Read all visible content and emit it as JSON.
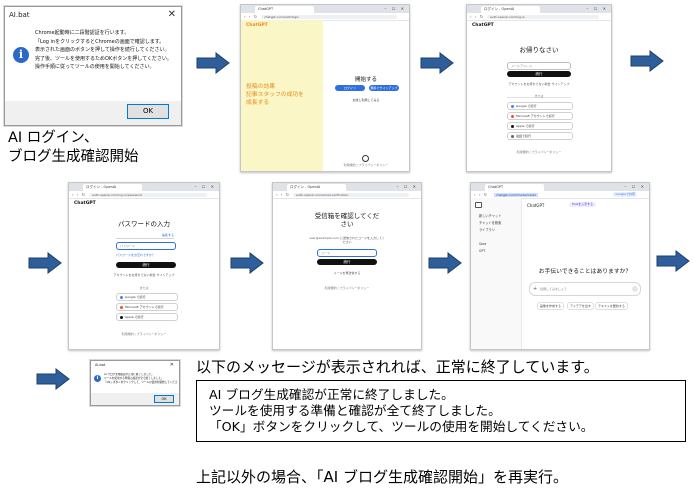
{
  "caption": {
    "line1": "AI ログイン、",
    "line2": "ブログ生成確認開始"
  },
  "dialog1": {
    "title": "AI.bat",
    "body_lines": [
      "Chrome起動時に二段階認証を行います。",
      "「Log inをクリックするとChromeの画面で確認します。",
      "表示された画面のボタンを押して操作を続行してください。",
      "完了後、ツールを使用するためOKボタンを押してください。",
      "操作手順に従ってツールの使用を開始してください。"
    ],
    "ok_label": "OK"
  },
  "screens": {
    "s2": {
      "tab": "ChatGPT",
      "url": "chatgpt.com/auth/login",
      "logo": "ChatGPT",
      "promo_lines": [
        "投稿の効果",
        "記事スタッフの成功を",
        "成長する"
      ],
      "heading": "開始する",
      "login_btn": "ログイン",
      "signup_btn": "無料でサインアップ",
      "trial_link": "お試し利用してみる",
      "footer": "利用規約 | プライバシーポリシー"
    },
    "s3": {
      "tab": "ログイン - OpenAI",
      "url": "auth.openai.com/log-in",
      "logo": "ChatGPT",
      "heading": "お帰りなさい",
      "email_placeholder": "メールアドレス",
      "continue_btn": "続行",
      "signup_text": "アカウントをお持ちでない場合 サインアップ",
      "or_text": "または",
      "providers": [
        "Google で続行",
        "Microsoft アカウントで続行",
        "Apple で続行",
        "電話で続行"
      ],
      "footer": "利用規約 | プライバシーポリシー"
    },
    "s4": {
      "tab": "ログイン - OpenAI",
      "url": "auth.openai.com/log-in/password",
      "logo": "ChatGPT",
      "heading": "パスワードの入力",
      "email_value": "user@example.com",
      "edit_link": "編集する",
      "password_placeholder": "パスワード",
      "forgot_link": "パスワードをお忘れですか？",
      "continue_btn": "続行",
      "signup_text": "アカウントをお持ちでない場合 サインアップ",
      "or_text": "または",
      "providers": [
        "Google で続行",
        "Microsoft アカウントで続行",
        "Apple で続行"
      ],
      "footer": "利用規約 | プライバシーポリシー"
    },
    "s5": {
      "tab": "ログイン - OpenAI",
      "url": "auth.openai.com/email-verification",
      "heading_line1": "受信箱を確認してくだ",
      "heading_line2": "さい",
      "desc": "user@example.com に送信されたコードを入力してください",
      "code_placeholder": "コード",
      "continue_btn": "続行",
      "resend_link": "メールを再送信する",
      "footer": "利用規約 | プライバシーポリシー"
    },
    "s6": {
      "tab": "ChatGPT",
      "url": "chatgpt.com/?model=auto",
      "share_btn": "Googleで共有",
      "model_label": "ChatGPT",
      "upgrade_btn": "Plusを入手する",
      "sidebar_items": [
        "新しいチャット",
        "チャットを検索",
        "ライブラリ",
        "Sora",
        "GPT"
      ],
      "prompt_heading": "お手伝いできることはありますか？",
      "input_placeholder": "質問してみましょう",
      "chips": [
        "画像を作成する",
        "アイデアを出す",
        "テキストを要約する"
      ]
    }
  },
  "dialog2": {
    "title": "AI.bat",
    "body_lines": [
      "AI ブログ生成確認が正常に終了しました。",
      "ツールを使用する準備と確認が全て終了しました。",
      "「OK」ボタンをクリックして、ツールの使用を開始してください。"
    ],
    "ok_label": "OK"
  },
  "message": {
    "heading": "以下のメッセージが表示されれば、正常に終了しています。",
    "lines": [
      "AI ブログ生成確認が正常に終了しました。",
      "ツールを使用する準備と確認が全て終了しました。",
      "「OK」ボタンをクリックして、ツールの使用を開始してください。"
    ],
    "rerun": "上記以外の場合、「AI ブログ生成確認開始」を再実行。"
  },
  "colors": {
    "arrow_blue": "#2e5f9a",
    "arrow_outline": "#1d3f6e",
    "info_blue": "#2a69c7",
    "promo_bg": "#fbf6c5",
    "promo_text": "#e88a1a",
    "button_blue": "#2f6fe0",
    "button_dark": "#111111"
  },
  "icons": [
    "info-icon",
    "close-icon",
    "arrow-right-icon"
  ]
}
